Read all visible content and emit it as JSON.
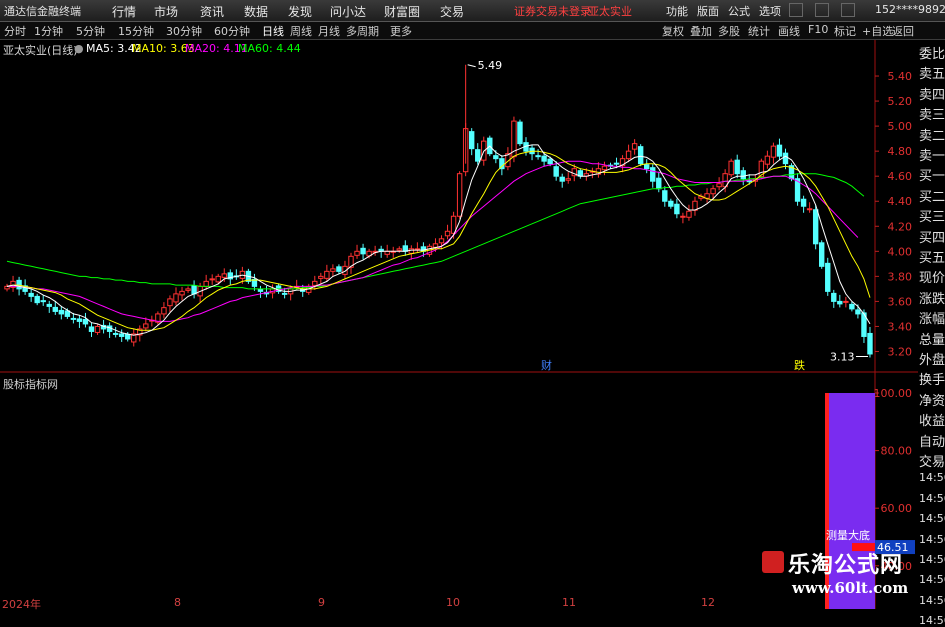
{
  "menubar": {
    "app_title": "通达信金融终端",
    "menus": [
      "行情",
      "市场",
      "资讯",
      "数据",
      "发现",
      "问小达",
      "财富圈",
      "交易"
    ],
    "warning": "证券交易未登录",
    "stock": "亚太实业",
    "right": [
      "功能",
      "版面",
      "公式",
      "选项"
    ],
    "user": "152****9892"
  },
  "toolbar": {
    "period_tabs": [
      "分时",
      "1分钟",
      "5分钟",
      "15分钟",
      "30分钟",
      "60分钟",
      "日线",
      "周线",
      "月线",
      "多周期",
      "更多"
    ],
    "active_tab": "日线",
    "right_tabs": [
      "复权",
      "叠加",
      "多股",
      "统计",
      "画线",
      "F10",
      "标记",
      "+自选",
      "返回"
    ]
  },
  "legend": {
    "name": "亚太实业(日线)",
    "ma5": "MA5: 3.42",
    "ma10": "MA10: 3.63",
    "ma20": "MA20: 4.11",
    "ma60": "MA60: 4.44",
    "colors": {
      "ma5": "#ffffff",
      "ma10": "#ffff00",
      "ma20": "#ff00ff",
      "ma60": "#00ff00"
    }
  },
  "chart_data": {
    "type": "candlestick",
    "y_ticks": [
      "5.40",
      "5.20",
      "5.00",
      "4.80",
      "4.60",
      "4.40",
      "4.20",
      "4.00",
      "3.80",
      "3.60",
      "3.40",
      "3.20"
    ],
    "ylim": [
      3.13,
      5.49
    ],
    "high_label": "5.49",
    "low_label": "3.13",
    "x_labels": [
      "2024年",
      "8",
      "9",
      "10",
      "11",
      "12"
    ],
    "markers": [
      "财",
      "跌"
    ],
    "closes": [
      3.72,
      3.76,
      3.7,
      3.68,
      3.64,
      3.59,
      3.6,
      3.56,
      3.52,
      3.5,
      3.48,
      3.46,
      3.44,
      3.42,
      3.36,
      3.4,
      3.38,
      3.36,
      3.34,
      3.32,
      3.3,
      3.34,
      3.38,
      3.42,
      3.45,
      3.5,
      3.55,
      3.62,
      3.66,
      3.68,
      3.7,
      3.66,
      3.72,
      3.76,
      3.78,
      3.8,
      3.82,
      3.78,
      3.8,
      3.84,
      3.76,
      3.72,
      3.68,
      3.66,
      3.7,
      3.68,
      3.66,
      3.7,
      3.72,
      3.68,
      3.72,
      3.76,
      3.8,
      3.84,
      3.86,
      3.84,
      3.88,
      3.96,
      4.0,
      3.98,
      4.0,
      4.0,
      4.0,
      4.0,
      4.0,
      4.02,
      4.0,
      4.02,
      4.02,
      4.0,
      4.04,
      4.06,
      4.1,
      4.16,
      4.28,
      4.62,
      4.98,
      4.82,
      4.72,
      4.88,
      4.78,
      4.74,
      4.66,
      4.78,
      5.04,
      4.86,
      4.8,
      4.78,
      4.76,
      4.72,
      4.7,
      4.6,
      4.56,
      4.58,
      4.66,
      4.6,
      4.62,
      4.64,
      4.66,
      4.68,
      4.68,
      4.7,
      4.74,
      4.8,
      4.86,
      4.7,
      4.66,
      4.56,
      4.5,
      4.4,
      4.36,
      4.3,
      4.28,
      4.32,
      4.4,
      4.44,
      4.46,
      4.5,
      4.54,
      4.62,
      4.72,
      4.62,
      4.58,
      4.56,
      4.58,
      4.72,
      4.76,
      4.84,
      4.76,
      4.7,
      4.58,
      4.4,
      4.36,
      4.34,
      4.06,
      3.88,
      3.68,
      3.6,
      3.58,
      3.6,
      3.54,
      3.5,
      3.32,
      3.18
    ],
    "ma5": [
      3.72,
      3.73,
      3.72,
      3.71,
      3.7,
      3.68,
      3.65,
      3.63,
      3.6,
      3.56,
      3.53,
      3.5,
      3.49,
      3.47,
      3.43,
      3.42,
      3.4,
      3.39,
      3.37,
      3.35,
      3.34,
      3.33,
      3.34,
      3.35,
      3.37,
      3.41,
      3.45,
      3.51,
      3.56,
      3.6,
      3.64,
      3.66,
      3.68,
      3.7,
      3.72,
      3.74,
      3.78,
      3.79,
      3.8,
      3.81,
      3.8,
      3.79,
      3.76,
      3.73,
      3.71,
      3.69,
      3.68,
      3.68,
      3.69,
      3.69,
      3.7,
      3.72,
      3.74,
      3.76,
      3.8,
      3.82,
      3.84,
      3.88,
      3.91,
      3.93,
      3.96,
      3.99,
      4.0,
      4.0,
      4.0,
      4.0,
      4.0,
      4.01,
      4.01,
      4.01,
      4.02,
      4.03,
      4.04,
      4.07,
      4.13,
      4.24,
      4.41,
      4.57,
      4.68,
      4.8,
      4.84,
      4.79,
      4.76,
      4.77,
      4.8,
      4.82,
      4.84,
      4.85,
      4.85,
      4.78,
      4.75,
      4.71,
      4.67,
      4.64,
      4.62,
      4.6,
      4.6,
      4.61,
      4.62,
      4.64,
      4.66,
      4.67,
      4.69,
      4.72,
      4.75,
      4.76,
      4.75,
      4.72,
      4.66,
      4.58,
      4.5,
      4.43,
      4.37,
      4.33,
      4.33,
      4.35,
      4.38,
      4.42,
      4.47,
      4.51,
      4.58,
      4.6,
      4.6,
      4.61,
      4.61,
      4.63,
      4.64,
      4.69,
      4.73,
      4.76,
      4.73,
      4.66,
      4.58,
      4.48,
      4.37,
      4.21,
      4.06,
      3.91,
      3.76,
      3.66,
      3.6,
      3.56,
      3.5,
      3.42
    ],
    "ma10": [
      3.72,
      3.73,
      3.73,
      3.72,
      3.71,
      3.7,
      3.69,
      3.68,
      3.67,
      3.65,
      3.62,
      3.6,
      3.58,
      3.55,
      3.52,
      3.49,
      3.47,
      3.45,
      3.43,
      3.41,
      3.39,
      3.38,
      3.37,
      3.37,
      3.37,
      3.38,
      3.39,
      3.42,
      3.45,
      3.48,
      3.52,
      3.55,
      3.59,
      3.63,
      3.66,
      3.69,
      3.71,
      3.73,
      3.74,
      3.76,
      3.77,
      3.77,
      3.77,
      3.76,
      3.75,
      3.74,
      3.73,
      3.72,
      3.71,
      3.7,
      3.7,
      3.7,
      3.71,
      3.72,
      3.74,
      3.76,
      3.78,
      3.8,
      3.82,
      3.84,
      3.86,
      3.88,
      3.9,
      3.92,
      3.94,
      3.96,
      3.97,
      3.98,
      3.99,
      4.0,
      4.01,
      4.02,
      4.02,
      4.04,
      4.06,
      4.12,
      4.21,
      4.3,
      4.38,
      4.46,
      4.55,
      4.63,
      4.68,
      4.72,
      4.76,
      4.78,
      4.79,
      4.8,
      4.8,
      4.79,
      4.78,
      4.76,
      4.73,
      4.7,
      4.68,
      4.66,
      4.65,
      4.64,
      4.63,
      4.63,
      4.63,
      4.63,
      4.64,
      4.65,
      4.67,
      4.69,
      4.7,
      4.7,
      4.69,
      4.67,
      4.63,
      4.58,
      4.54,
      4.5,
      4.46,
      4.44,
      4.42,
      4.41,
      4.41,
      4.42,
      4.45,
      4.48,
      4.51,
      4.54,
      4.57,
      4.61,
      4.64,
      4.66,
      4.67,
      4.68,
      4.67,
      4.65,
      4.62,
      4.58,
      4.52,
      4.44,
      4.36,
      4.26,
      4.16,
      4.06,
      3.96,
      3.88,
      3.78,
      3.63
    ],
    "ma20": [
      3.72,
      3.72,
      3.72,
      3.71,
      3.71,
      3.7,
      3.7,
      3.69,
      3.68,
      3.67,
      3.66,
      3.65,
      3.64,
      3.62,
      3.6,
      3.58,
      3.56,
      3.54,
      3.52,
      3.5,
      3.49,
      3.48,
      3.47,
      3.46,
      3.45,
      3.44,
      3.44,
      3.44,
      3.45,
      3.46,
      3.47,
      3.49,
      3.5,
      3.52,
      3.54,
      3.56,
      3.58,
      3.6,
      3.61,
      3.63,
      3.64,
      3.65,
      3.66,
      3.67,
      3.68,
      3.69,
      3.7,
      3.71,
      3.72,
      3.72,
      3.72,
      3.72,
      3.73,
      3.73,
      3.74,
      3.75,
      3.76,
      3.77,
      3.78,
      3.79,
      3.81,
      3.83,
      3.85,
      3.87,
      3.89,
      3.9,
      3.92,
      3.94,
      3.95,
      3.97,
      3.99,
      4.01,
      4.04,
      4.08,
      4.13,
      4.18,
      4.23,
      4.28,
      4.32,
      4.36,
      4.4,
      4.44,
      4.48,
      4.52,
      4.56,
      4.59,
      4.62,
      4.64,
      4.66,
      4.68,
      4.69,
      4.7,
      4.71,
      4.72,
      4.72,
      4.72,
      4.71,
      4.7,
      4.7,
      4.69,
      4.68,
      4.68,
      4.67,
      4.67,
      4.66,
      4.66,
      4.65,
      4.64,
      4.63,
      4.62,
      4.6,
      4.58,
      4.57,
      4.56,
      4.55,
      4.55,
      4.55,
      4.55,
      4.55,
      4.56,
      4.56,
      4.56,
      4.56,
      4.57,
      4.57,
      4.58,
      4.59,
      4.6,
      4.6,
      4.6,
      4.58,
      4.56,
      4.53,
      4.5,
      4.46,
      4.41,
      4.36,
      4.31,
      4.26,
      4.21,
      4.16,
      4.11
    ],
    "ma60": [
      3.92,
      3.91,
      3.9,
      3.89,
      3.88,
      3.87,
      3.86,
      3.85,
      3.84,
      3.83,
      3.82,
      3.81,
      3.8,
      3.8,
      3.79,
      3.79,
      3.78,
      3.78,
      3.77,
      3.77,
      3.76,
      3.76,
      3.75,
      3.75,
      3.74,
      3.74,
      3.74,
      3.74,
      3.73,
      3.73,
      3.73,
      3.73,
      3.72,
      3.72,
      3.72,
      3.72,
      3.71,
      3.71,
      3.71,
      3.71,
      3.7,
      3.7,
      3.7,
      3.7,
      3.7,
      3.7,
      3.7,
      3.7,
      3.7,
      3.71,
      3.71,
      3.72,
      3.72,
      3.73,
      3.74,
      3.75,
      3.76,
      3.77,
      3.78,
      3.79,
      3.8,
      3.81,
      3.82,
      3.83,
      3.84,
      3.85,
      3.86,
      3.87,
      3.88,
      3.89,
      3.9,
      3.91,
      3.92,
      3.94,
      3.96,
      3.98,
      4.0,
      4.02,
      4.04,
      4.06,
      4.08,
      4.1,
      4.12,
      4.14,
      4.16,
      4.18,
      4.2,
      4.22,
      4.24,
      4.26,
      4.28,
      4.3,
      4.32,
      4.34,
      4.36,
      4.38,
      4.39,
      4.4,
      4.41,
      4.42,
      4.43,
      4.44,
      4.45,
      4.46,
      4.47,
      4.48,
      4.49,
      4.5,
      4.5,
      4.51,
      4.51,
      4.52,
      4.52,
      4.53,
      4.53,
      4.54,
      4.54,
      4.55,
      4.55,
      4.56,
      4.56,
      4.57,
      4.57,
      4.58,
      4.58,
      4.59,
      4.59,
      4.6,
      4.6,
      4.61,
      4.61,
      4.62,
      4.62,
      4.62,
      4.62,
      4.61,
      4.6,
      4.59,
      4.57,
      4.55,
      4.52,
      4.48,
      4.44
    ]
  },
  "sub": {
    "title": "股标指标网",
    "y_ticks": [
      "100.00",
      "80.00",
      "60.00",
      "40.00"
    ],
    "ylim": [
      25,
      100
    ],
    "bar_top": 100,
    "bar_level": 46.51,
    "value_label": "46.51",
    "label": "测量大底",
    "colors": {
      "bar": "#ff2020",
      "fill": "#7a2cf0"
    }
  },
  "side_labels": [
    "委比",
    "卖五",
    "卖四",
    "卖三",
    "卖二",
    "卖一",
    "买一",
    "买二",
    "买三",
    "买四",
    "买五",
    "现价",
    "涨跌",
    "涨幅",
    "总量",
    "外盘",
    "换手",
    "净资",
    "收益",
    "自动",
    "交易",
    "14:56",
    "14:56",
    "14:56",
    "14:56",
    "14:56",
    "14:56",
    "14:56",
    "14:56"
  ],
  "watermark": {
    "big": "乐淘公式网",
    "small": "www.60lt.com"
  }
}
